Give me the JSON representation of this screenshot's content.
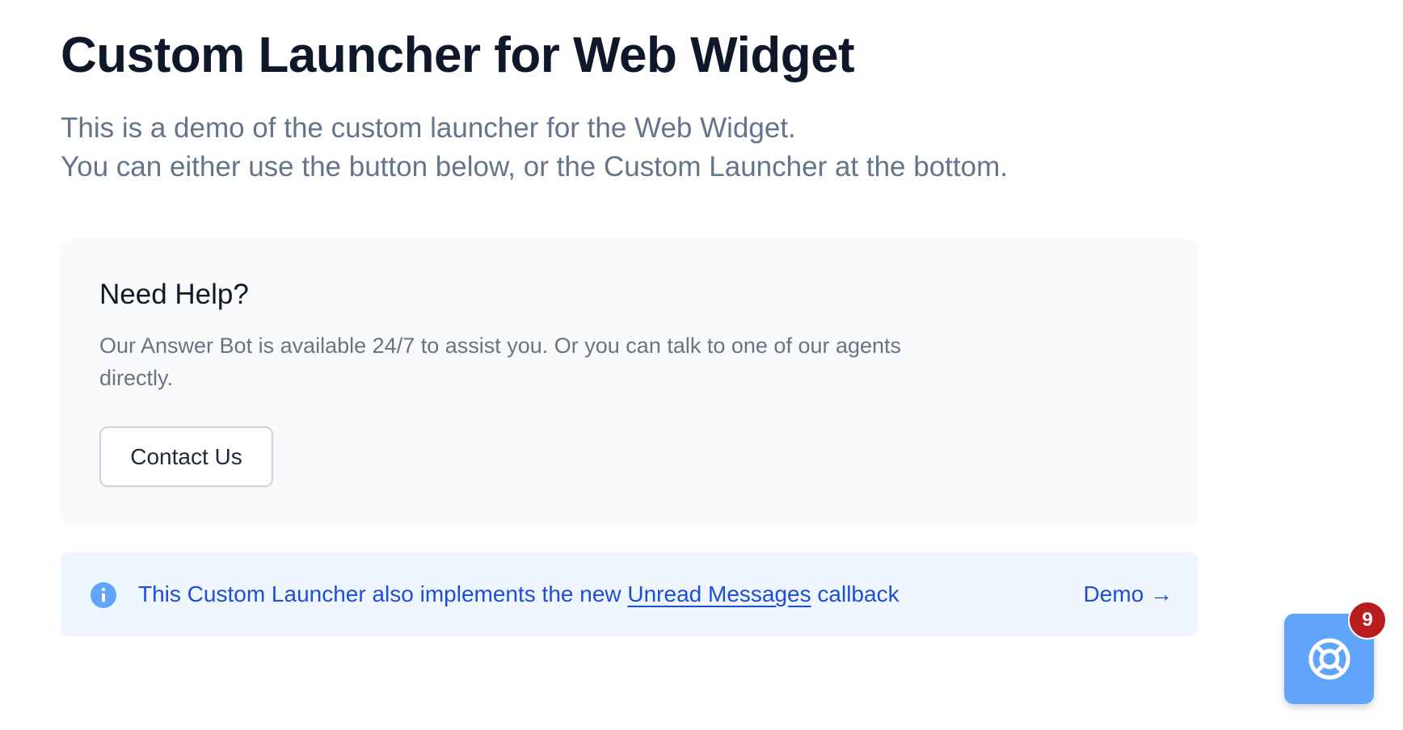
{
  "page": {
    "title": "Custom Launcher for Web Widget",
    "intro_line1": "This is a demo of the custom launcher for the Web Widget.",
    "intro_line2": "You can either use the button below, or the Custom Launcher at the bottom."
  },
  "help_card": {
    "title": "Need Help?",
    "text": "Our Answer Bot is available 24/7 to assist you. Or you can talk to one of our agents directly.",
    "button_label": "Contact Us"
  },
  "info_banner": {
    "icon": "info-icon",
    "text_before": "This Custom Launcher also implements the new ",
    "link_label": "Unread Messages",
    "text_after": " callback",
    "demo_label": "Demo →"
  },
  "launcher": {
    "icon": "lifebuoy-icon",
    "unread_count": "9"
  },
  "colors": {
    "title": "#0f172a",
    "muted_text": "#64748b",
    "card_background": "#f8fafc",
    "banner_background": "#eff6ff",
    "banner_text": "#1d4ed8",
    "launcher_background": "#60a5fa",
    "badge_background": "#b91c1c"
  }
}
